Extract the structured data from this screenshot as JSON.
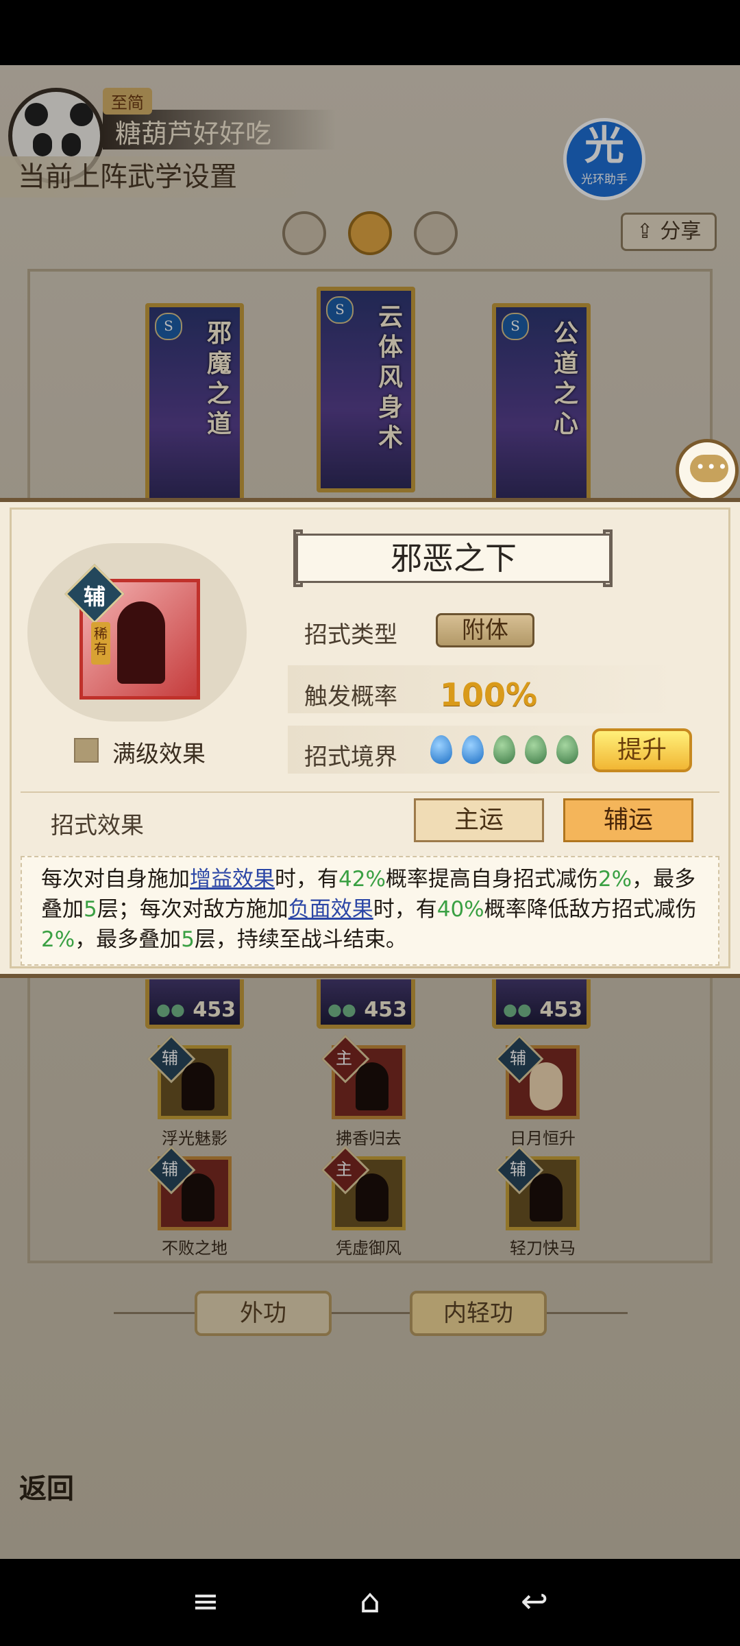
{
  "player": {
    "rank_tag": "至简",
    "name": "糖葫芦好好吃"
  },
  "section_title": "当前上阵武学设置",
  "overlay_badge": {
    "glyph": "光",
    "label": "光环助手"
  },
  "share": {
    "icon": "share-icon",
    "label": "分享"
  },
  "cards": [
    {
      "title": "邪魔之道",
      "level": ""
    },
    {
      "title": "云体风身术",
      "level": "453"
    },
    {
      "title": "公道之心",
      "level": "453"
    }
  ],
  "card_bottom_values": [
    "453",
    "453",
    "453"
  ],
  "skills": [
    {
      "tag": "辅",
      "name": "浮光魅影"
    },
    {
      "tag": "主",
      "name": "拂香归去"
    },
    {
      "tag": "辅",
      "name": "日月恒升"
    },
    {
      "tag": "辅",
      "name": "不败之地"
    },
    {
      "tag": "主",
      "name": "凭虚御风"
    },
    {
      "tag": "辅",
      "name": "轻刀快马"
    }
  ],
  "bottom_tabs": {
    "outer": "外功",
    "inner": "内轻功"
  },
  "back_label": "返回",
  "modal": {
    "icon_tag": "辅",
    "icon_vertical": "稀有",
    "title": "邪恶之下",
    "full_level_label": "满级效果",
    "rows": {
      "type_label": "招式类型",
      "type_value": "附体",
      "prob_label": "触发概率",
      "prob_value": "100%",
      "realm_label": "招式境界",
      "realm_filled": 2,
      "realm_total": 5
    },
    "upgrade_label": "提升",
    "effect_label": "招式效果",
    "btn_main": "主运",
    "btn_aux": "辅运",
    "desc": {
      "p1": "每次对自身施加",
      "link1": "增益效果",
      "p2": "时，有",
      "n1": "42%",
      "p3": "概率提高自身招式减伤",
      "n2": "2%",
      "p4": "，最多叠加",
      "n3": "5",
      "p5": "层；每次对敌方施加",
      "link2": "负面效果",
      "p6": "时，有",
      "n4": "40%",
      "p7": "概率降低敌方招式减伤",
      "n5": "2%",
      "p8": "，最多叠加",
      "n6": "5",
      "p9": "层，持续至战斗结束。"
    }
  },
  "nav": {
    "menu": "≡",
    "home": "⌂",
    "back": "↩"
  },
  "colors": {
    "accent_gold": "#f1b634",
    "link_blue": "#2b46a6",
    "number_green": "#3aa043",
    "frame_brown": "#6e5535"
  }
}
